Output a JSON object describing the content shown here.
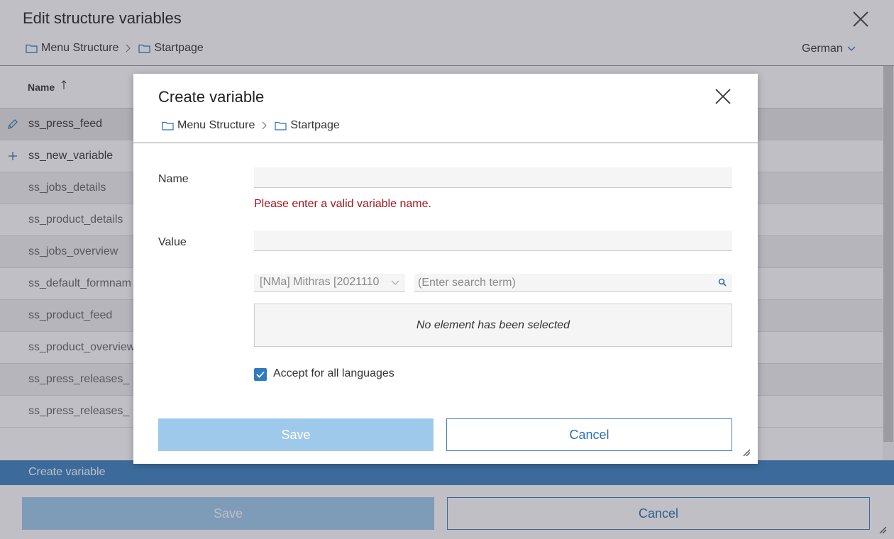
{
  "background": {
    "title": "Edit structure variables",
    "breadcrumb": [
      "Menu Structure",
      "Startpage"
    ],
    "language": "German",
    "table": {
      "column_name": "Name",
      "rows": [
        {
          "name": "ss_press_feed",
          "state": "editing"
        },
        {
          "name": "ss_new_variable",
          "state": "new"
        },
        {
          "name": "ss_jobs_details",
          "state": ""
        },
        {
          "name": "ss_product_details",
          "state": ""
        },
        {
          "name": "ss_jobs_overview",
          "state": ""
        },
        {
          "name": "ss_default_formnam",
          "state": ""
        },
        {
          "name": "ss_product_feed",
          "state": ""
        },
        {
          "name": "ss_product_overview",
          "state": ""
        },
        {
          "name": "ss_press_releases_",
          "state": ""
        },
        {
          "name": "ss_press_releases_",
          "state": ""
        }
      ]
    },
    "create_variable": "Create variable",
    "save_label": "Save",
    "cancel_label": "Cancel"
  },
  "dialog": {
    "title": "Create variable",
    "breadcrumb": [
      "Menu Structure",
      "Startpage"
    ],
    "name_label": "Name",
    "name_value": "",
    "name_error": "Please enter a valid variable name.",
    "value_label": "Value",
    "value_value": "",
    "project_select": "[NMa] Mithras [2021110",
    "search_placeholder": "(Enter search term)",
    "selection_text": "No element has been selected",
    "accept_all_languages_label": "Accept for all languages",
    "accept_all_languages_checked": true,
    "save_label": "Save",
    "cancel_label": "Cancel"
  },
  "colors": {
    "accent": "#3d82c0",
    "error": "#a0161c",
    "disabled_button": "#9fc9ea"
  }
}
